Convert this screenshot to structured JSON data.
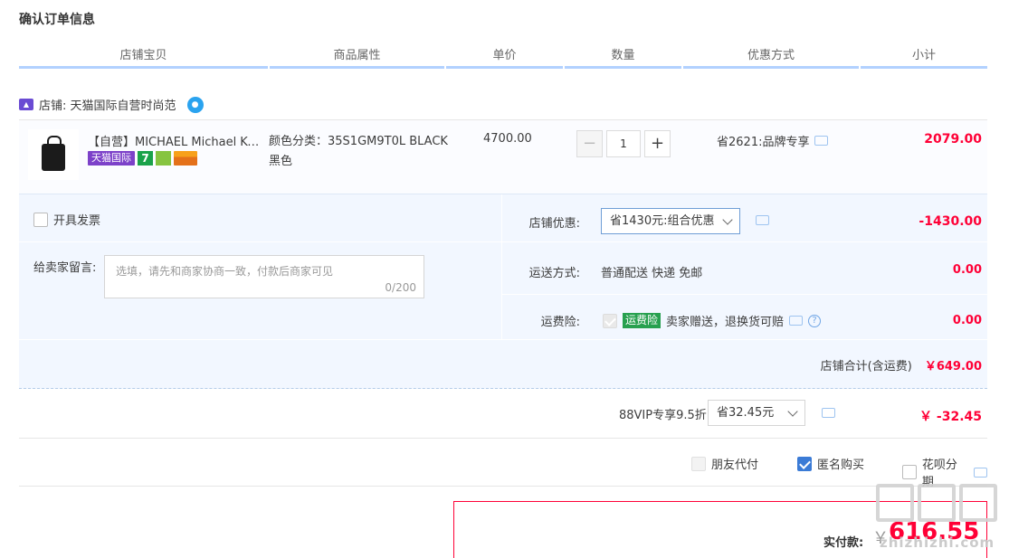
{
  "page": {
    "title": "确认订单信息"
  },
  "columns": [
    "店铺宝贝",
    "商品属性",
    "单价",
    "数量",
    "优惠方式",
    "小计"
  ],
  "shop": {
    "label": "店铺: 天猫国际自营时尚范"
  },
  "item": {
    "title": "【自营】MICHAEL Michael Ko...",
    "badges": {
      "intl": "天猫国际",
      "seven": "7"
    },
    "attr_line1": "颜色分类：35S1GM9T0L BLACK",
    "attr_line2": "黑色",
    "unit_price": "4700.00",
    "quantity": "1",
    "qty_minus": "−",
    "qty_plus": "+",
    "promo": "省2621:品牌专享",
    "subtotal": "2079.00"
  },
  "panel": {
    "invoice_label": "开具发票",
    "message_label": "给卖家留言:",
    "message_placeholder": "选填，请先和商家协商一致，付款后商家可见",
    "message_count": "0/200",
    "shop_discount_label": "店铺优惠:",
    "shop_discount_option": "省1430元:组合优惠",
    "shop_discount_value": "-1430.00",
    "shipping_label": "运送方式:",
    "shipping_method": "普通配送 快递 免邮",
    "shipping_value": "0.00",
    "insurance_label": "运费险:",
    "insurance_badge": "运费险",
    "insurance_text": "卖家赠送，退换货可赔",
    "insurance_value": "0.00",
    "shop_total_label": "店铺合计(含运费)",
    "shop_total_value": "￥649.00"
  },
  "vip": {
    "label": "88VIP专享9.5折",
    "option": "省32.45元",
    "value": "￥ -32.45"
  },
  "options": {
    "friend_pay": "朋友代付",
    "anonymous": "匿名购买",
    "huabei": "花呗分期"
  },
  "payment": {
    "label": "实付款:",
    "currency": "￥",
    "amount": "616.55"
  },
  "watermark": {
    "text": "zhizhizhi.com"
  },
  "colors": {
    "accent_red": "#ff0036",
    "panel_blue": "#f2f7ff",
    "header_line": "#b2d1ff"
  }
}
